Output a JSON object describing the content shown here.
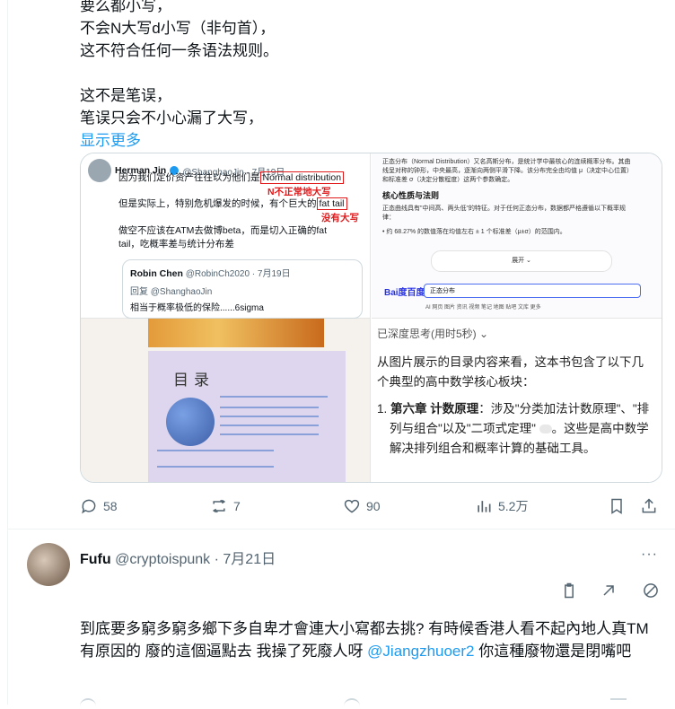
{
  "post": {
    "lines": [
      "要么都小写，",
      "不会N大写d小写（非句首），",
      "这不符合任何一条语法规则。",
      "",
      "这不是笔误，",
      "笔误只会不小心漏了大写，"
    ],
    "show_more": "显示更多"
  },
  "media": {
    "tweet": {
      "name": "Herman Jin",
      "handle": "@ShanghaoJin · 7月19日",
      "line1_pre": "因为我们定价资产往往以为他们是",
      "line1_box": "Normal distribution",
      "note1": "N不正常地大写",
      "line2_pre": "但是实际上，特别危机爆发的时候，有个巨大的",
      "line2_box": "fat tail",
      "note2": "没有大写",
      "line3": "做空不应该在ATM去做博beta，而是切入正确的fat",
      "line4": "tail，吃概率差与统计分布差",
      "quote_name": "Robin Chen",
      "quote_handle": "@RobinCh2020 · 7月19日",
      "quote_reply": "回复 @ShanghaoJin",
      "quote_text": "相当于概率极低的保险......6sigma"
    },
    "baidu": {
      "line1": "正态分布（Normal Distribution）又名高斯分布，是统计学中最核心的连续概率分布。其曲",
      "line2": "线呈对称的钟形，中央最高，逐渐向两侧平滑下降。该分布完全由均值 μ（决定中心位置）",
      "line3": "和标准差 σ（决定分散程度）这两个参数确定。",
      "heading": "核心性质与法则",
      "line4": "正态曲线具有\"中间高、两头低\"的特征。对于任何正态分布，数据都严格遵循以下概率规",
      "line5": "律：",
      "line6": "• 约 68.27% 的数值落在均值左右 ± 1 个标准差（μ±σ）的范围内。",
      "expand": "展开 ⌄",
      "logo": "Bai度百度",
      "search_value": "正态分布",
      "tabs": "AI   网页   图片   资讯   视频   笔记   地图   贴吧   文库   更多"
    },
    "book": {
      "toc_title": "目录"
    },
    "ai": {
      "thinking": "已深度思考(用时5秒) ⌄",
      "para1": "从图片展示的目录内容来看，这本书包含了以下几个典型的高中数学核心板块：",
      "item1_num": "1.",
      "item1_bold": "第六章 计数原理",
      "item1_rest": "：涉及\"分类加法计数原理\"、\"排列与组合\"以及\"二项式定理\"",
      "item1_tail": "。这些是高中数学解决排列组合和概率计算的基础工具。"
    }
  },
  "actions": {
    "replies": "58",
    "retweets": "7",
    "likes": "90",
    "views": "5.2万"
  },
  "reply": {
    "name": "Fufu",
    "meta": "@cryptoispunk · 7月21日",
    "more": "···",
    "text_pre": "到底要多窮多窮多鄉下多自卑才會連大小寫都去挑? 有時候香港人看不起內地人真TM有原因的 廢的這個逼點去 我操了死廢人呀 ",
    "mention": "@Jiangzhuoer2",
    "text_post": " 你這種廢物還是閉嘴吧"
  },
  "colors": {
    "accent": "#1d9bf0",
    "annotation_red": "#e0191b",
    "muted": "#536471"
  }
}
